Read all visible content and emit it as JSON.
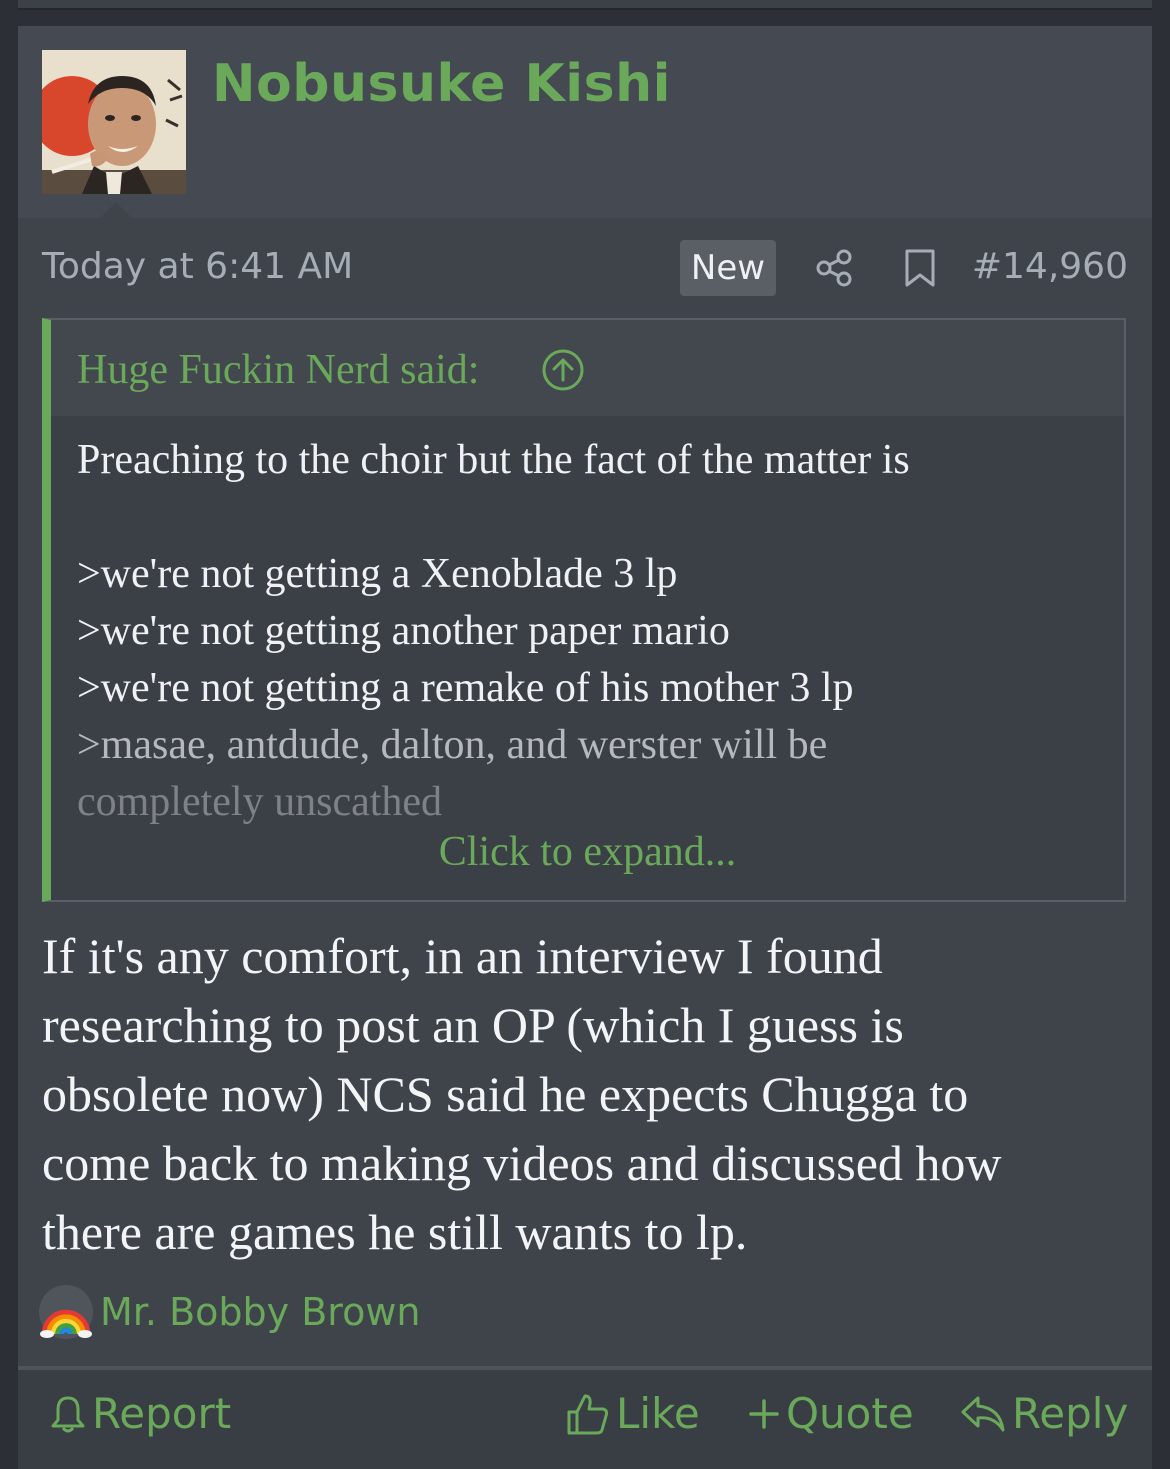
{
  "post": {
    "username": "Nobusuke Kishi",
    "date": "Today at 6:41 AM",
    "badge": "New",
    "number": "#14,960",
    "quote": {
      "author": "Huge Fuckin Nerd said:",
      "lines": [
        "Preaching to the choir but the fact of the matter is",
        "",
        ">we're not getting a Xenoblade 3 lp",
        ">we're not getting another paper mario",
        ">we're not getting a remake of his mother 3 lp",
        ">masae, antdude, dalton, and werster will be",
        "completely unscathed"
      ],
      "expand": "Click to expand..."
    },
    "body_lines": [
      "If it's any comfort, in an interview I found",
      "researching to post an OP (which I guess is",
      "obsolete now) NCS said he expects Chugga to",
      "come back to making videos and discussed how",
      "there are games he still wants to lp."
    ],
    "reactions": {
      "icon": "rainbow-icon",
      "users": "Mr. Bobby Brown"
    },
    "actions": {
      "report": "Report",
      "like": "Like",
      "quote": "Quote",
      "reply": "Reply"
    }
  },
  "colors": {
    "accent": "#6aa85a",
    "background": "#2c3036",
    "post_bg": "#3f444b"
  }
}
